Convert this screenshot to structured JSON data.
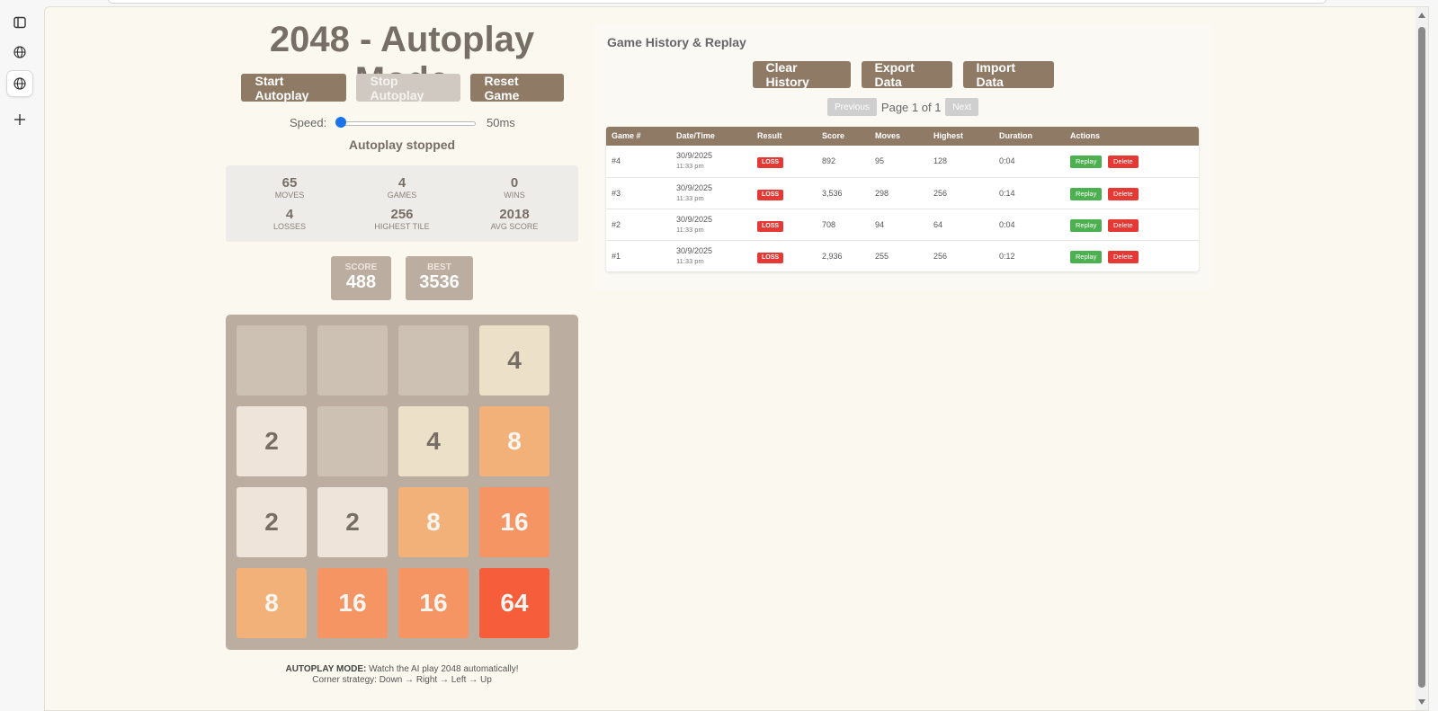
{
  "game": {
    "title": "2048 - Autoplay Mode",
    "buttons": {
      "start": "Start Autoplay",
      "stop": "Stop Autoplay",
      "reset": "Reset Game"
    },
    "speed": {
      "label": "Speed:",
      "value": "50ms",
      "level_fraction": 0.0
    },
    "status": "Autoplay stopped",
    "stats": [
      {
        "value": "65",
        "label": "MOVES"
      },
      {
        "value": "4",
        "label": "GAMES"
      },
      {
        "value": "0",
        "label": "WINS"
      },
      {
        "value": "4",
        "label": "LOSSES"
      },
      {
        "value": "256",
        "label": "HIGHEST TILE"
      },
      {
        "value": "2018",
        "label": "AVG SCORE"
      }
    ],
    "score": {
      "label": "SCORE",
      "value": "488"
    },
    "best": {
      "label": "BEST",
      "value": "3536"
    },
    "board": [
      [
        null,
        null,
        null,
        4
      ],
      [
        2,
        null,
        4,
        8
      ],
      [
        2,
        2,
        8,
        16
      ],
      [
        8,
        16,
        16,
        64
      ]
    ],
    "footer": {
      "mode_label": "AUTOPLAY MODE:",
      "mode_text": "Watch the AI play 2048 automatically!",
      "strategy": "Corner strategy: Down → Right → Left → Up"
    }
  },
  "history": {
    "title": "Game History & Replay",
    "buttons": {
      "clear": "Clear History",
      "export": "Export Data",
      "import": "Import Data"
    },
    "pager": {
      "previous": "Previous",
      "page_text": "Page 1 of 1",
      "next": "Next"
    },
    "columns": [
      "Game #",
      "Date/Time",
      "Result",
      "Score",
      "Moves",
      "Highest",
      "Duration",
      "Actions"
    ],
    "rows": [
      {
        "game": "#4",
        "date": "30/9/2025",
        "time": "11:33 pm",
        "result": "LOSS",
        "score": "892",
        "moves": "95",
        "highest": "128",
        "duration": "0:04"
      },
      {
        "game": "#3",
        "date": "30/9/2025",
        "time": "11:33 pm",
        "result": "LOSS",
        "score": "3,536",
        "moves": "298",
        "highest": "256",
        "duration": "0:14"
      },
      {
        "game": "#2",
        "date": "30/9/2025",
        "time": "11:33 pm",
        "result": "LOSS",
        "score": "708",
        "moves": "94",
        "highest": "64",
        "duration": "0:04"
      },
      {
        "game": "#1",
        "date": "30/9/2025",
        "time": "11:33 pm",
        "result": "LOSS",
        "score": "2,936",
        "moves": "255",
        "highest": "256",
        "duration": "0:12"
      }
    ],
    "row_actions": {
      "replay": "Replay",
      "delete": "Delete"
    }
  },
  "colors": {
    "accent": "#8f7a66",
    "board": "#bbada0",
    "empty_cell": "#cdc1b4",
    "loss": "#e53935",
    "replay": "#4caf50"
  },
  "icons": [
    "sidebar-toggle-icon",
    "globe-icon",
    "globe-icon",
    "plus-icon"
  ]
}
